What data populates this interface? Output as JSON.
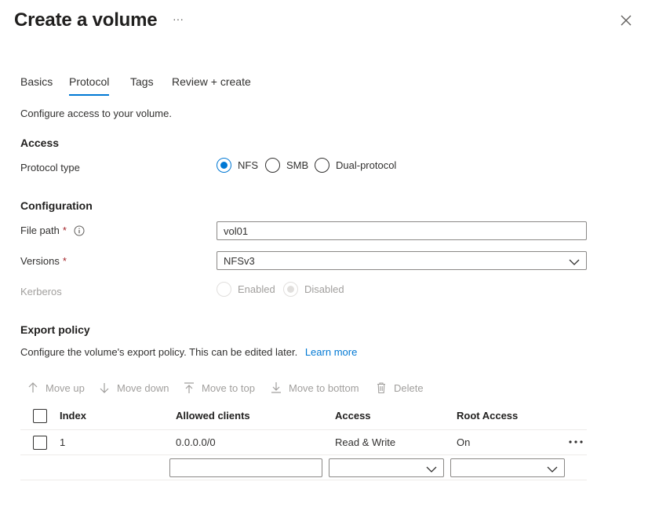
{
  "header": {
    "title": "Create a volume",
    "more_label": "···"
  },
  "tabs": [
    {
      "label": "Basics",
      "active": false
    },
    {
      "label": "Protocol",
      "active": true
    },
    {
      "label": "Tags",
      "active": false
    },
    {
      "label": "Review + create",
      "active": false
    }
  ],
  "intro": "Configure access to your volume.",
  "access": {
    "heading": "Access",
    "protocol_label": "Protocol type",
    "options": [
      {
        "label": "NFS",
        "checked": true
      },
      {
        "label": "SMB",
        "checked": false
      },
      {
        "label": "Dual-protocol",
        "checked": false
      }
    ]
  },
  "configuration": {
    "heading": "Configuration",
    "file_path_label": "File path",
    "file_path_value": "vol01",
    "versions_label": "Versions",
    "versions_value": "NFSv3",
    "required_mark": "*",
    "kerberos_label": "Kerberos",
    "kerberos_options": [
      {
        "label": "Enabled",
        "checked": false
      },
      {
        "label": "Disabled",
        "checked": true
      }
    ]
  },
  "export_policy": {
    "heading": "Export policy",
    "description": "Configure the volume's export policy. This can be edited later.",
    "learn_more": "Learn more",
    "toolbar": {
      "move_up": "Move up",
      "move_down": "Move down",
      "move_to_top": "Move to top",
      "move_to_bottom": "Move to bottom",
      "delete": "Delete"
    },
    "columns": [
      "Index",
      "Allowed clients",
      "Access",
      "Root Access"
    ],
    "rows": [
      {
        "index": "1",
        "allowed_clients": "0.0.0.0/0",
        "access": "Read & Write",
        "root_access": "On"
      }
    ],
    "row_more": "•••"
  },
  "colors": {
    "accent": "#0078d4",
    "required": "#a4262c",
    "disabled": "#a19f9d"
  }
}
